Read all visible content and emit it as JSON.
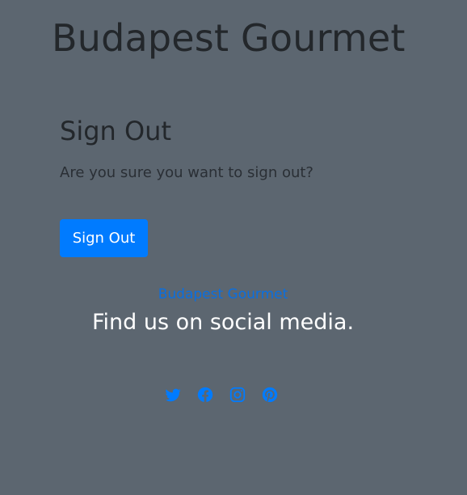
{
  "site": {
    "title": "Budapest Gourmet"
  },
  "signout": {
    "heading": "Sign Out",
    "message": "Are you sure you want to sign out?",
    "button_label": "Sign Out"
  },
  "footer": {
    "brand_link": "Budapest Gourmet",
    "tagline": "Find us on social media.",
    "social_icons": [
      "twitter-icon",
      "facebook-icon",
      "instagram-icon",
      "pinterest-icon"
    ]
  },
  "colors": {
    "background": "#5c6670",
    "accent": "#007bff",
    "heading_text": "#23272b",
    "tagline_text": "#ffffff"
  }
}
